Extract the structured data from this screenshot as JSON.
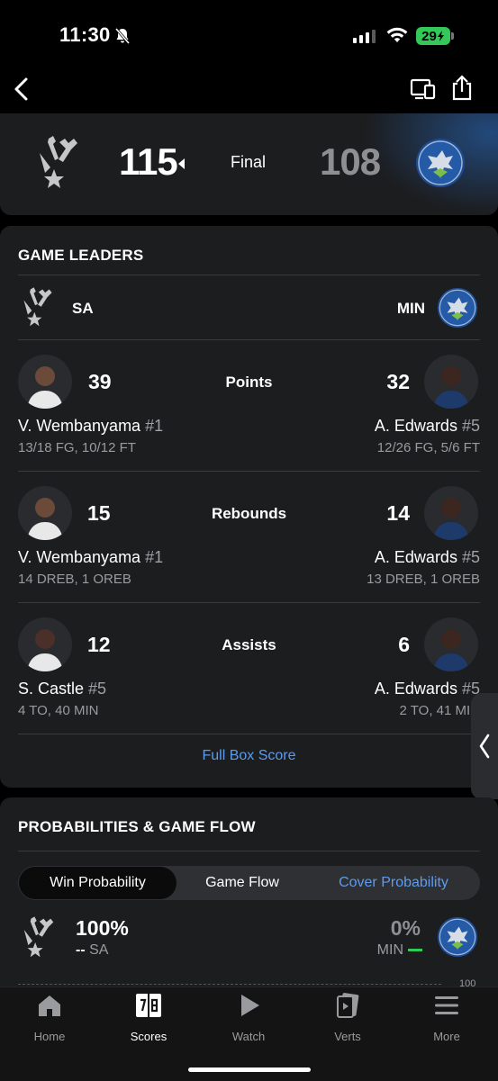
{
  "status_bar": {
    "time": "11:30",
    "battery": "29"
  },
  "game": {
    "home": {
      "abbr": "SA",
      "score": "115"
    },
    "away": {
      "abbr": "MIN",
      "score": "108"
    },
    "status": "Final"
  },
  "leaders": {
    "title": "GAME LEADERS",
    "categories": [
      {
        "label": "Points",
        "home": {
          "value": "39",
          "name": "V. Wembanyama",
          "number": "#1",
          "line": "13/18 FG, 10/12 FT"
        },
        "away": {
          "value": "32",
          "name": "A. Edwards",
          "number": "#5",
          "line": "12/26 FG, 5/6 FT"
        }
      },
      {
        "label": "Rebounds",
        "home": {
          "value": "15",
          "name": "V. Wembanyama",
          "number": "#1",
          "line": "14 DREB, 1 OREB"
        },
        "away": {
          "value": "14",
          "name": "A. Edwards",
          "number": "#5",
          "line": "13 DREB, 1 OREB"
        }
      },
      {
        "label": "Assists",
        "home": {
          "value": "12",
          "name": "S. Castle",
          "number": "#5",
          "line": "4 TO, 40 MIN"
        },
        "away": {
          "value": "6",
          "name": "A. Edwards",
          "number": "#5",
          "line": "2 TO, 41 MIN"
        }
      }
    ],
    "full_box_label": "Full Box Score"
  },
  "probabilities": {
    "title": "PROBABILITIES & GAME FLOW",
    "tabs": [
      "Win Probability",
      "Game Flow",
      "Cover Probability"
    ],
    "active_tab": "Win Probability",
    "home": {
      "pct": "100%",
      "sub_prefix": "--",
      "abbr": "SA"
    },
    "away": {
      "pct": "0%",
      "abbr": "MIN"
    },
    "axis_value": "100"
  },
  "tabbar": {
    "items": [
      {
        "label": "Home",
        "icon": "home-icon"
      },
      {
        "label": "Scores",
        "icon": "scores-icon"
      },
      {
        "label": "Watch",
        "icon": "play-icon"
      },
      {
        "label": "Verts",
        "icon": "verts-icon"
      },
      {
        "label": "More",
        "icon": "menu-icon"
      }
    ],
    "active": "Scores"
  },
  "colors": {
    "accent": "#5b9cf0",
    "card": "#1c1d1f",
    "green": "#34c759"
  }
}
